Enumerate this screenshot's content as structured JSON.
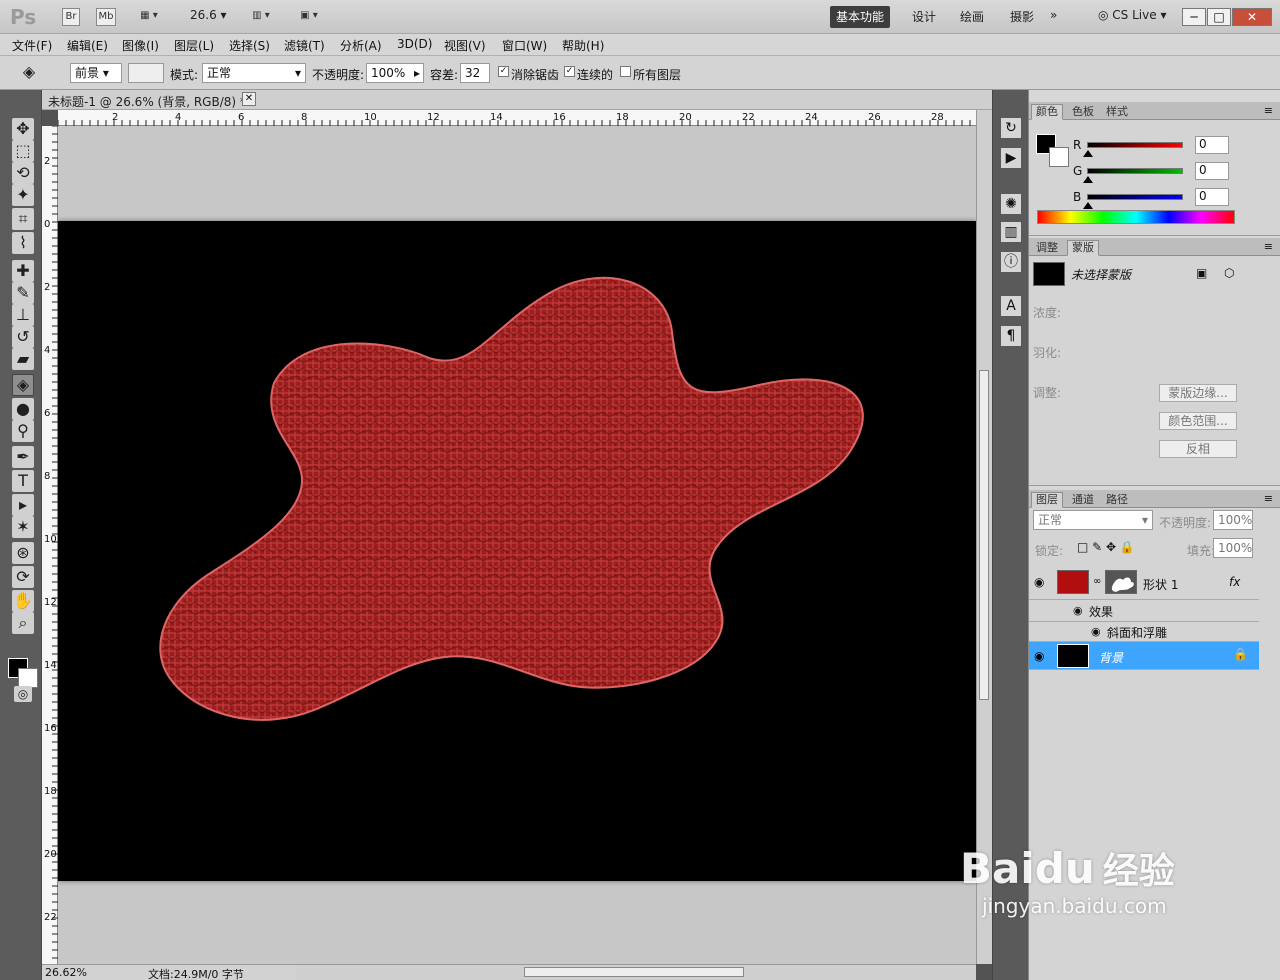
{
  "app": {
    "logo": "Ps",
    "bridge_label": "Br",
    "minibridge_label": "Mb",
    "zoom_value": "26.6",
    "workspace_tabs": [
      {
        "label": "基本功能",
        "active": true
      },
      {
        "label": "设计",
        "active": false
      },
      {
        "label": "绘画",
        "active": false
      },
      {
        "label": "摄影",
        "active": false
      }
    ],
    "more": "»",
    "cs_live": "CS Live",
    "window_controls": [
      "─",
      "□",
      "✕"
    ]
  },
  "menu": [
    "文件(F)",
    "编辑(E)",
    "图像(I)",
    "图层(L)",
    "选择(S)",
    "滤镜(T)",
    "分析(A)",
    "3D(D)",
    "视图(V)",
    "窗口(W)",
    "帮助(H)"
  ],
  "options": {
    "fill_source": "前景",
    "mode_label": "模式:",
    "mode_value": "正常",
    "opacity_label": "不透明度:",
    "opacity_value": "100%",
    "tolerance_label": "容差:",
    "tolerance_value": "32",
    "antialias_label": "消除锯齿",
    "contiguous_label": "连续的",
    "all_layers_label": "所有图层"
  },
  "document": {
    "tab_title": "未标题-1 @ 26.6% (背景, RGB/8) *",
    "close": "✕",
    "status_zoom": "26.62%",
    "status_doc": "文档:24.9M/0 字节"
  },
  "ruler": {
    "top_ticks": [
      "2",
      "4",
      "6",
      "8",
      "10",
      "12",
      "14",
      "16",
      "18",
      "20",
      "22",
      "24",
      "26",
      "28"
    ],
    "left_ticks": [
      "2",
      "0",
      "2",
      "4",
      "6",
      "8",
      "10",
      "12",
      "14",
      "16",
      "18",
      "20",
      "22"
    ]
  },
  "panels": {
    "color": {
      "tabs": [
        "颜色",
        "色板",
        "样式"
      ],
      "channels": [
        {
          "name": "R",
          "value": "0",
          "color": "#ff0000"
        },
        {
          "name": "G",
          "value": "0",
          "color": "#00c000"
        },
        {
          "name": "B",
          "value": "0",
          "color": "#0000ff"
        }
      ]
    },
    "mask": {
      "tabs": [
        "调整",
        "蒙版"
      ],
      "title": "未选择蒙版",
      "density": "浓度:",
      "feather": "羽化:",
      "refine": "调整:",
      "buttons": [
        "蒙版边缘...",
        "颜色范围...",
        "反相"
      ]
    },
    "layers": {
      "tabs": [
        "图层",
        "通道",
        "路径"
      ],
      "blend_mode": "正常",
      "opacity_label": "不透明度:",
      "opacity_value": "100%",
      "lock_label": "锁定:",
      "fill_label": "填充:",
      "fill_value": "100%",
      "items": [
        {
          "name": "形状 1",
          "fx": "fx",
          "effect": "效果",
          "subeffect": "斜面和浮雕"
        },
        {
          "name": "背景"
        }
      ]
    }
  },
  "watermark": {
    "brand": "Bai",
    "brand_suffix": "du",
    "product": "经验",
    "url": "jingyan.baidu.com"
  }
}
